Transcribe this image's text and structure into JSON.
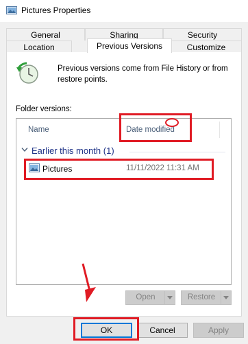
{
  "window": {
    "title": "Pictures Properties",
    "title_icon": "pictures-folder-icon"
  },
  "tabs": {
    "back_row": [
      "General",
      "Sharing",
      "Security"
    ],
    "front_row": [
      "Location",
      "Previous Versions",
      "Customize"
    ],
    "active": "Previous Versions"
  },
  "info": {
    "icon": "history-clock-icon",
    "text": "Previous versions come from File History or from restore points."
  },
  "versions": {
    "label": "Folder versions:",
    "columns": [
      "Name",
      "Date modified"
    ],
    "group": {
      "label": "Earlier this month (1)"
    },
    "rows": [
      {
        "icon": "pictures-folder-icon",
        "name": "Pictures",
        "date": "11/11/2022 11:31 AM"
      }
    ]
  },
  "actions": {
    "open": "Open",
    "restore": "Restore"
  },
  "buttons": {
    "ok": "OK",
    "cancel": "Cancel",
    "apply": "Apply"
  },
  "colors": {
    "accent": "#0078d7",
    "annotation": "#e01b24",
    "group_text": "#1e3287"
  }
}
